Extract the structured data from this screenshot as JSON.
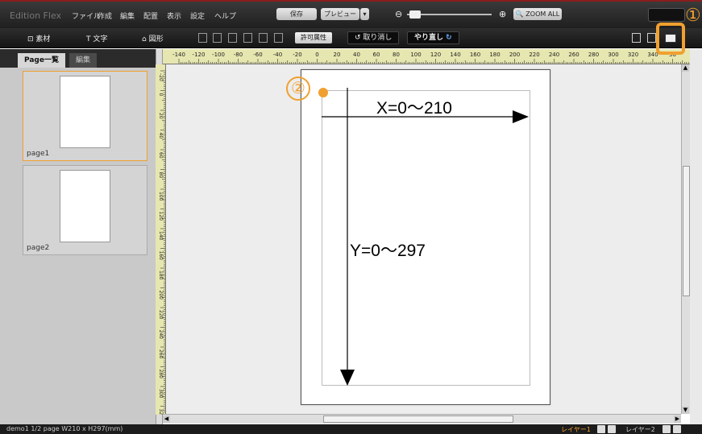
{
  "app": {
    "title": "Edition Flex"
  },
  "menu": {
    "items": [
      "ファイル",
      "作成",
      "編集",
      "配置",
      "表示",
      "設定",
      "ヘルプ"
    ],
    "save_label": "保存",
    "preview_label": "プレビュー",
    "zoom_all_label": "ZOOM ALL",
    "zoom_minus": "⊖",
    "zoom_plus": "⊕"
  },
  "toolbar": {
    "material_label": "素材",
    "text_label": "T 文字",
    "shape_label": "図形",
    "permission_label": "許可属性",
    "undo_label": "取り消し",
    "redo_label": "やり直し"
  },
  "sidepanel": {
    "tabs": [
      {
        "label": "Page一覧",
        "active": true
      },
      {
        "label": "編集",
        "active": false
      }
    ],
    "pages": [
      {
        "label": "page1",
        "selected": true
      },
      {
        "label": "page2",
        "selected": false
      }
    ]
  },
  "ruler": {
    "horizontal_ticks": [
      "-140",
      "-120",
      "-100",
      "-80",
      "-60",
      "-40",
      "-20",
      "0",
      "20",
      "40",
      "60",
      "80",
      "100",
      "120",
      "140",
      "160",
      "180",
      "200",
      "220",
      "240",
      "260",
      "280",
      "300",
      "320",
      "340",
      "36"
    ],
    "vertical_ticks": [
      "-20",
      "0",
      "20",
      "40",
      "60",
      "80",
      "100",
      "120",
      "140",
      "160",
      "180",
      "200",
      "220",
      "240",
      "260",
      "280",
      "300",
      "320"
    ]
  },
  "canvas": {
    "x_annotation": "X=0～210",
    "y_annotation": "Y=0～297"
  },
  "callouts": {
    "one": "①",
    "two": "②"
  },
  "statusbar": {
    "text": "demo1  1/2 page  W210 x H297(mm)",
    "layer1": "レイヤー1",
    "layer2": "レイヤー2"
  },
  "colors": {
    "accent": "#f0a030",
    "menubar_top": "#8a1d1d"
  }
}
